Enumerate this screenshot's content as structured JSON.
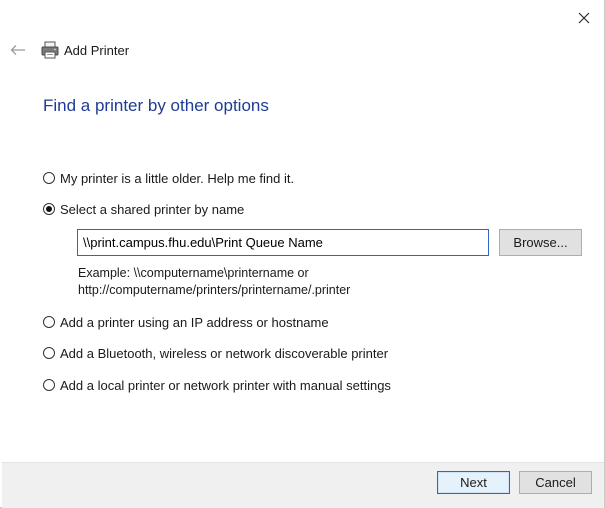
{
  "window": {
    "title": "Add Printer"
  },
  "heading": "Find a printer by other options",
  "options": [
    {
      "label": "My printer is a little older. Help me find it.",
      "selected": false
    },
    {
      "label": "Select a shared printer by name",
      "selected": true
    },
    {
      "label": "Add a printer using an IP address or hostname",
      "selected": false
    },
    {
      "label": "Add a Bluetooth, wireless or network discoverable printer",
      "selected": false
    },
    {
      "label": "Add a local printer or network printer with manual settings",
      "selected": false
    }
  ],
  "shared_printer": {
    "value": "\\\\print.campus.fhu.edu\\Print Queue Name",
    "browse_label": "Browse...",
    "example_line1": "Example: \\\\computername\\printername or",
    "example_line2": "http://computername/printers/printername/.printer"
  },
  "footer": {
    "next_label": "Next",
    "cancel_label": "Cancel"
  },
  "colors": {
    "heading": "#1f3b94",
    "focus_border": "#2f66c4",
    "footer_bg": "#f0f0f0"
  },
  "icons": {
    "close": "close-icon",
    "back": "back-arrow-icon",
    "title": "printer-icon"
  }
}
